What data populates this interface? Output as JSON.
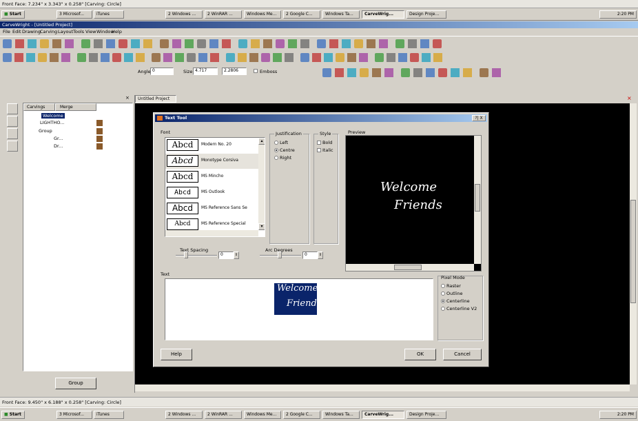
{
  "top_status": "Front Face: 7.234\" x 3.343\" x 0.258\" [Carving: Circle]",
  "bottom_status": "Front Face: 9.450\" x 6.188\" x 0.258\" [Carving: Circle]",
  "taskbar": {
    "start": "Start",
    "items": [
      "3 Microsof...",
      "iTunes",
      "2 Windows ...",
      "2 WinRAR ...",
      "Windows Me...",
      "2 Google C...",
      "Windows Ta...",
      "CarveWrig...",
      "Design Proje..."
    ],
    "clock": "2:20 PM"
  },
  "app": {
    "title": "CarveWright - [Untitled Project]",
    "menu": [
      "File",
      "Edit",
      "Drawing",
      "Carving",
      "Layout",
      "Tools",
      "View",
      "Window",
      "Help"
    ],
    "format_bar": {
      "angle_label": "Angle",
      "angle_value": "0",
      "size_label": "Size",
      "size_value": "4.717",
      "size2_value": "2.2806",
      "emboss_label": "Emboss"
    }
  },
  "tree": {
    "headers": [
      "Carvings",
      "Merge"
    ],
    "items": [
      "Welcome",
      "LIGHTHO...",
      "Group",
      "Gr...",
      "Dr..."
    ],
    "group_button": "Group"
  },
  "doc_tab": "Untitled Project",
  "dialog": {
    "title": "Text Tool",
    "font_label": "Font",
    "fonts": [
      {
        "sample": "Abcd",
        "name": "Modern No. 20"
      },
      {
        "sample": "Abcd",
        "name": "Monotype Corsiva"
      },
      {
        "sample": "Abcd",
        "name": "MS Mincho"
      },
      {
        "sample": "Abcd",
        "name": "MS Outlook"
      },
      {
        "sample": "Abcd",
        "name": "MS Reference Sans Se"
      },
      {
        "sample": "Abcd",
        "name": "MS Reference Special"
      }
    ],
    "justification_label": "Justification",
    "justification": [
      "Left",
      "Centre",
      "Right"
    ],
    "style_label": "Style",
    "style": [
      "Bold",
      "Italic"
    ],
    "preview_label": "Preview",
    "preview_line1": "Welcome",
    "preview_line2": "Friends",
    "text_spacing_label": "Text Spacing",
    "text_spacing_value": "0",
    "arc_degrees_label": "Arc Degrees",
    "arc_degrees_value": "0",
    "text_label": "Text",
    "text_line1": "Welcome",
    "text_line2": "Friends",
    "pixel_mode_label": "Pixel Mode",
    "pixel_modes": [
      "Raster",
      "Outline",
      "Centerline",
      "Centerline V2"
    ],
    "help": "Help",
    "ok": "OK",
    "cancel": "Cancel",
    "close": "?| X"
  },
  "colors": {
    "accent": "#0a246a",
    "canvas": "#000000",
    "selection": "#0a246a"
  }
}
